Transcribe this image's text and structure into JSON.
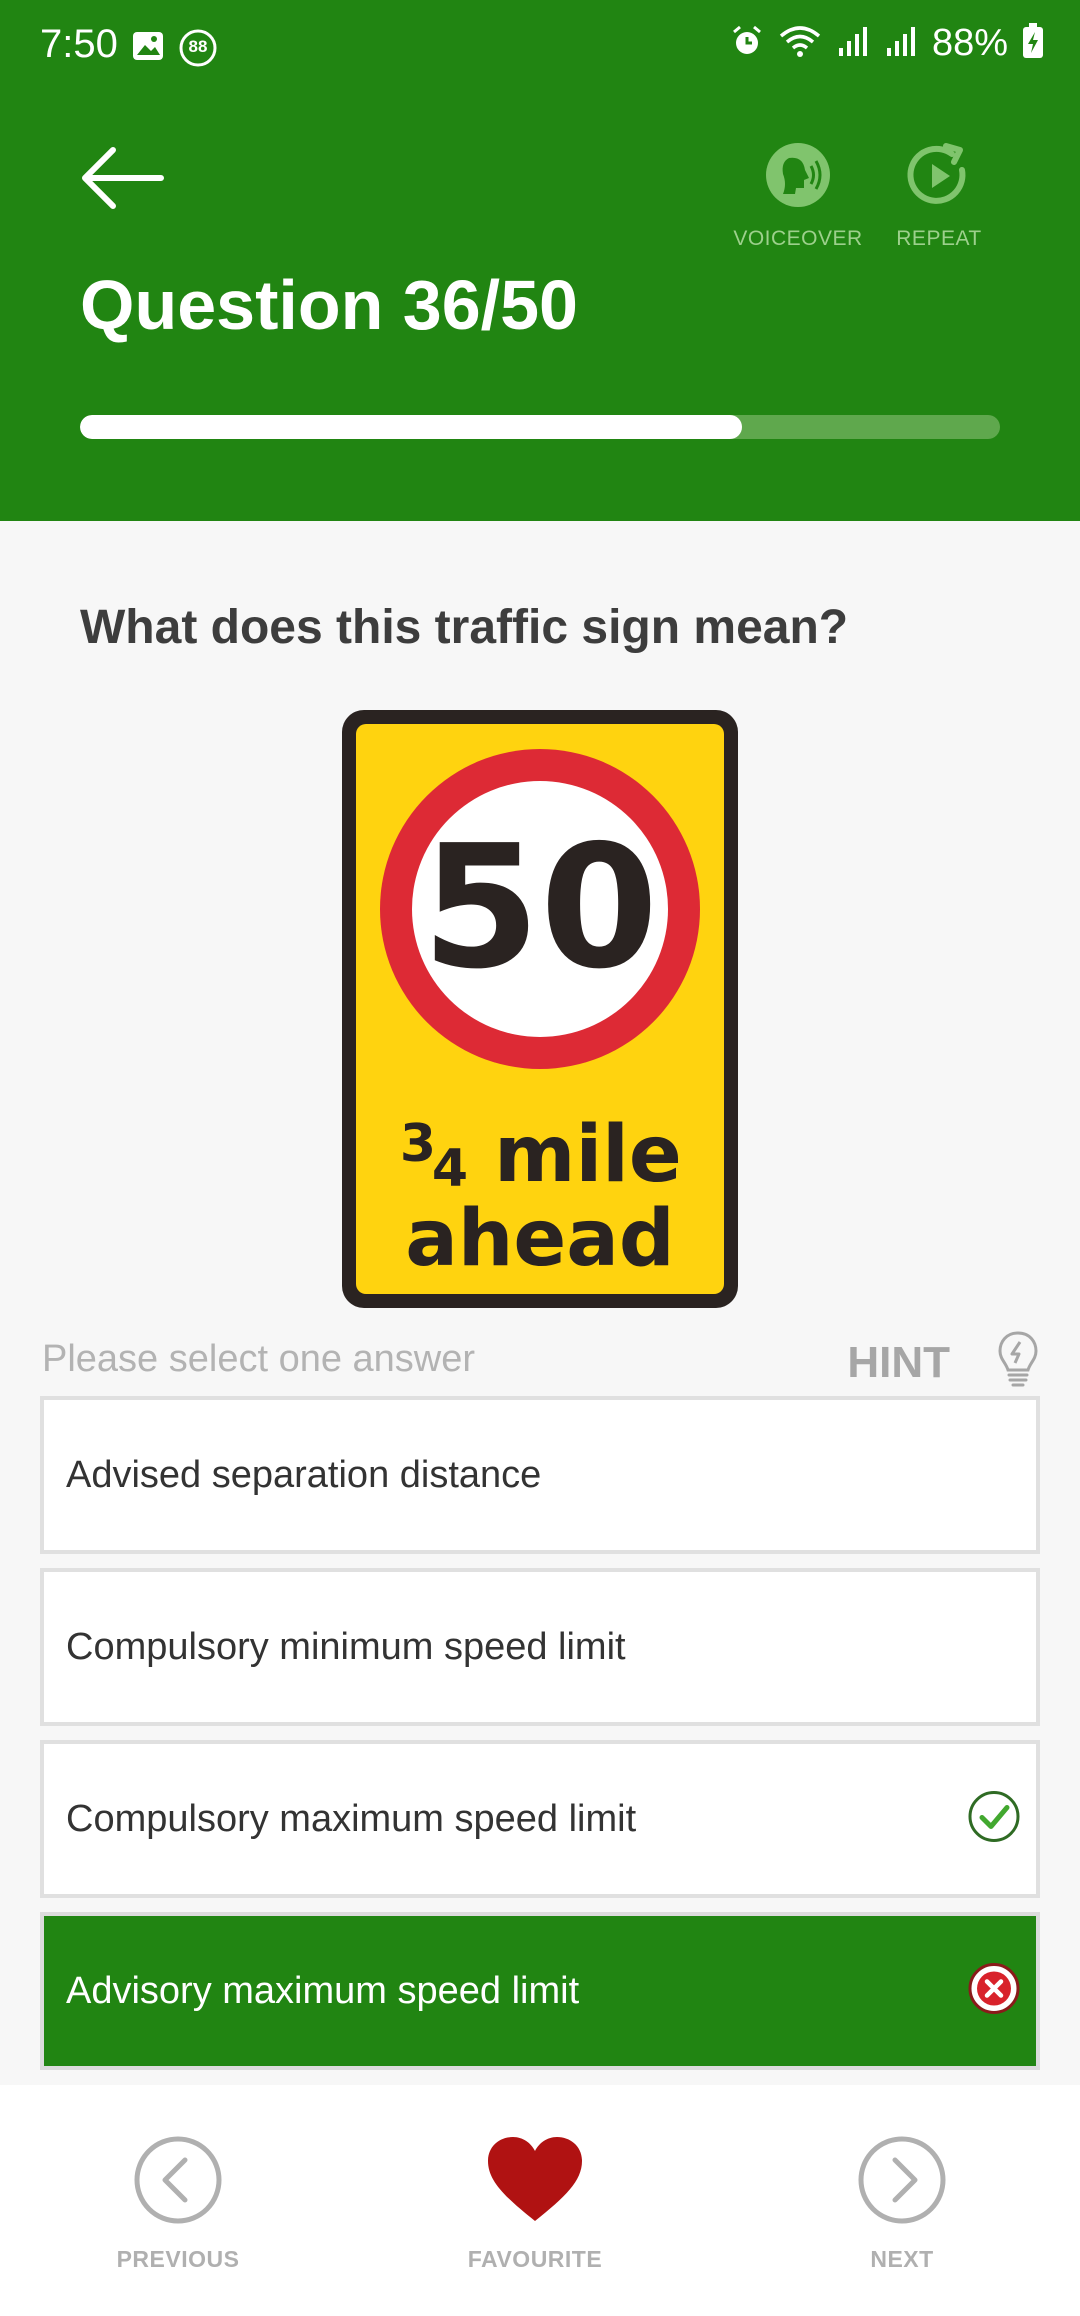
{
  "status_bar": {
    "time": "7:50",
    "battery": "88%",
    "badge": "88"
  },
  "header": {
    "title": "Question 36/50",
    "progress_current": 36,
    "progress_total": 50,
    "voiceover_label": "VOICEOVER",
    "repeat_label": "REPEAT"
  },
  "question": {
    "prompt": "What does this traffic sign mean?",
    "sign": {
      "speed": "50",
      "fraction_numerator": "3",
      "fraction_denominator": "4",
      "line1_word": "mile",
      "line2": "ahead"
    }
  },
  "instructions": "Please select one answer",
  "hint_label": "HINT",
  "answers": [
    {
      "text": "Advised separation distance",
      "state": "none"
    },
    {
      "text": "Compulsory minimum speed limit",
      "state": "none"
    },
    {
      "text": "Compulsory maximum speed limit",
      "state": "correct"
    },
    {
      "text": "Advisory maximum speed limit",
      "state": "selected-wrong"
    }
  ],
  "bottom_nav": {
    "previous_label": "PREVIOUS",
    "favourite_label": "FAVOURITE",
    "next_label": "NEXT"
  },
  "colors": {
    "brand_green": "#218512",
    "sign_yellow": "#ffd30f",
    "sign_red": "#dd2a35",
    "favourite_red": "#b01212"
  },
  "icons": [
    "image-icon",
    "badge-icon",
    "alarm-icon",
    "wifi-icon",
    "signal-icon",
    "battery-icon",
    "back-arrow-icon",
    "voiceover-icon",
    "repeat-icon",
    "lightbulb-icon",
    "check-icon",
    "cross-icon",
    "chevron-left-icon",
    "heart-icon",
    "chevron-right-icon"
  ]
}
